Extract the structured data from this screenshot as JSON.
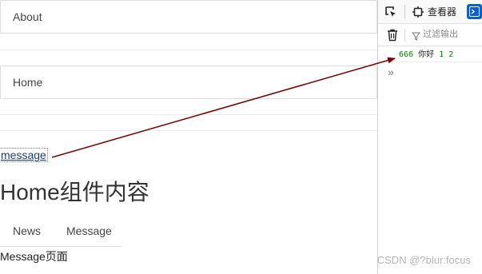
{
  "nav": {
    "about_label": "About",
    "home_label": "Home"
  },
  "main": {
    "message_link": "message",
    "heading": "Home组件内容",
    "tabs": [
      {
        "label": "News"
      },
      {
        "label": "Message"
      }
    ],
    "message_page_text": "Message页面"
  },
  "devtools": {
    "inspector_label": "查看器",
    "filter_placeholder": "过滤输出",
    "console_output": {
      "num1": "666",
      "str": "你好",
      "num2": "1",
      "num3": "2"
    },
    "prompt_glyph": "»",
    "accent_color": "#0b5fd1"
  },
  "annotation": {
    "arrow_color": "#7a0a0a"
  },
  "watermark": "CSDN @?blur:focus"
}
